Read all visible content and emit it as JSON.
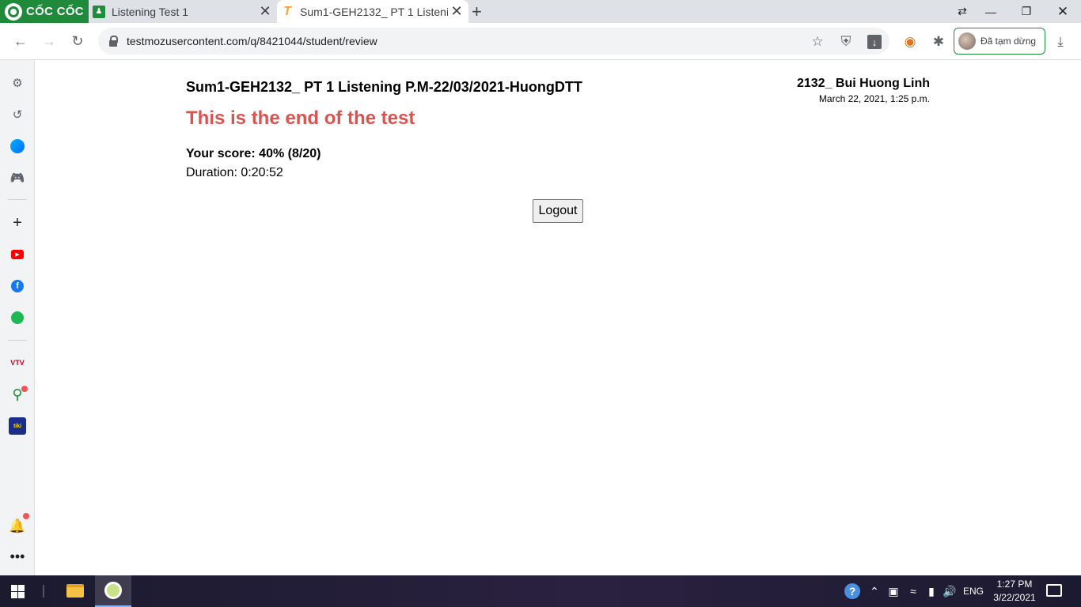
{
  "browser": {
    "brand_name": "CỐC CỐC",
    "tabs": [
      {
        "title": "Listening Test 1",
        "icon": "google-classroom-icon"
      },
      {
        "title": "Sum1-GEH2132_ PT 1 Listening P.M-22/03/2021-HuongDTT",
        "icon": "testmoz-icon",
        "active": true
      }
    ],
    "new_tab_label": "+",
    "url": "testmozusercontent.com/q/8421044/student/review",
    "profile_label": "Đã tạm dừng",
    "accent_color": "#1f8a3a"
  },
  "sidebar": {
    "items": [
      "settings-icon",
      "history-icon",
      "messenger-icon",
      "games-icon",
      "add-icon",
      "youtube-icon",
      "facebook-icon",
      "spotify-icon",
      "vtv-go-icon",
      "coccoc-maps-icon",
      "tiki-icon",
      "bell-icon",
      "more-icon"
    ],
    "vtv_label": "VTV",
    "tiki_label": "tiki"
  },
  "page": {
    "test_title": "Sum1-GEH2132_ PT 1 Listening P.M-22/03/2021-HuongDTT",
    "student_name": "2132_ Bui Huong Linh",
    "student_date": "March 22, 2021, 1:25 p.m.",
    "end_heading": "This is the end of the test",
    "score_text": "Your score: 40% (8/20)",
    "duration_text": "Duration: 0:20:52",
    "logout_label": "Logout",
    "heading_color": "#d9534f"
  },
  "taskbar": {
    "language": "ENG",
    "time": "1:27 PM",
    "date": "3/22/2021"
  }
}
